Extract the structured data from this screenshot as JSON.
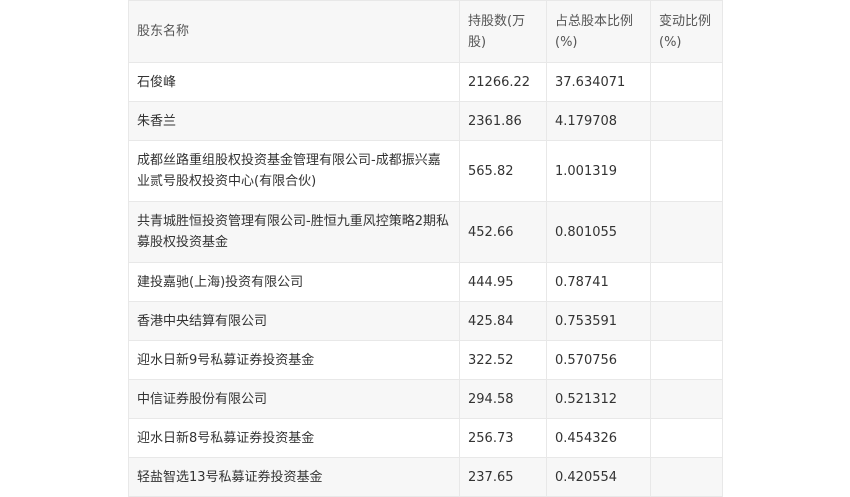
{
  "table": {
    "headers": [
      "股东名称",
      "持股数(万股)",
      "占总股本比例(%)",
      "变动比例(%)"
    ],
    "rows": [
      {
        "name": "石俊峰",
        "shares": "21266.22",
        "ratio": "37.634071",
        "change": ""
      },
      {
        "name": "朱香兰",
        "shares": "2361.86",
        "ratio": "4.179708",
        "change": ""
      },
      {
        "name": "成都丝路重组股权投资基金管理有限公司-成都振兴嘉业贰号股权投资中心(有限合伙)",
        "shares": "565.82",
        "ratio": "1.001319",
        "change": ""
      },
      {
        "name": "共青城胜恒投资管理有限公司-胜恒九重风控策略2期私募股权投资基金",
        "shares": "452.66",
        "ratio": "0.801055",
        "change": ""
      },
      {
        "name": "建投嘉驰(上海)投资有限公司",
        "shares": "444.95",
        "ratio": "0.78741",
        "change": ""
      },
      {
        "name": "香港中央结算有限公司",
        "shares": "425.84",
        "ratio": "0.753591",
        "change": ""
      },
      {
        "name": "迎水日新9号私募证券投资基金",
        "shares": "322.52",
        "ratio": "0.570756",
        "change": ""
      },
      {
        "name": "中信证券股份有限公司",
        "shares": "294.58",
        "ratio": "0.521312",
        "change": ""
      },
      {
        "name": "迎水日新8号私募证券投资基金",
        "shares": "256.73",
        "ratio": "0.454326",
        "change": ""
      },
      {
        "name": "轻盐智选13号私募证券投资基金",
        "shares": "237.65",
        "ratio": "0.420554",
        "change": ""
      }
    ]
  }
}
